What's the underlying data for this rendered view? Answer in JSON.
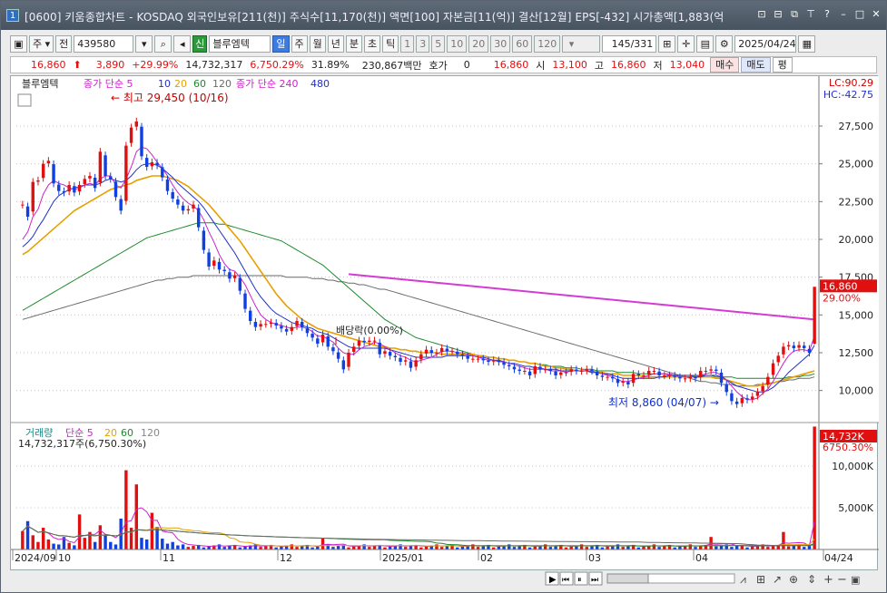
{
  "window": {
    "number": "1",
    "title": "[0600] 키움종합차트 - KOSDAQ 외국인보유[211(천)] 주식수[11,170(천)] 액면[100] 자본금[11(억)] 결산[12월] EPS[-432] 시가총액[1,883(억"
  },
  "toolbar": {
    "market": "주",
    "prev_label": "전",
    "code": "439580",
    "tag": "신",
    "name": "블루엠텍",
    "periods": [
      "일",
      "주",
      "월",
      "년",
      "분",
      "초",
      "틱"
    ],
    "active_period": "일",
    "intervals": [
      "1",
      "3",
      "5",
      "10",
      "20",
      "30",
      "60",
      "120"
    ],
    "count": "145",
    "total": "/331",
    "date": "2025/04/24"
  },
  "quote": {
    "price": "16,860",
    "change": "3,890",
    "change_pct": "+29.99%",
    "volume": "14,732,317",
    "volume_pct": "6,750.29%",
    "turnover": "31.89%",
    "amount": "230,867백만",
    "bid_label": "호가",
    "bid_value": "0",
    "bid_price": "16,860",
    "open_label": "시",
    "open": "13,100",
    "high_label": "고",
    "high": "16,860",
    "low_label": "저",
    "low": "13,040",
    "buy": "매수",
    "sell": "매도",
    "flat": "평"
  },
  "chart_data": [
    {
      "type": "candlestick",
      "legend": [
        "블루엠텍",
        "종가 단순 5",
        "10",
        "20",
        "60",
        "120",
        "종가 단순 240",
        "480"
      ],
      "y_ticks": [
        10000,
        12500,
        15000,
        17500,
        20000,
        22500,
        25000,
        27500
      ],
      "ylim": [
        8000,
        30800
      ],
      "indicators": {
        "lc": "LC:90.29",
        "hc": "HC:-42.75"
      },
      "last_price_label": "16,860",
      "last_pct_label": "29.00%",
      "annotations": {
        "high": "최고 29,450 (10/16)",
        "low": "최저 8,860 (04/07)",
        "dividend": "배당락(0.00%)"
      },
      "x_labels": [
        "2024/09",
        "10",
        "11",
        "12",
        "2025/01",
        "02",
        "03",
        "04",
        "04/24"
      ],
      "closes": [
        22300,
        21500,
        23800,
        23900,
        25000,
        25200,
        23700,
        23200,
        23100,
        23600,
        23100,
        23600,
        24000,
        24200,
        23400,
        25800,
        24200,
        24000,
        22800,
        21900,
        26200,
        27400,
        27800,
        25500,
        24800,
        25100,
        24900,
        24100,
        23200,
        22700,
        22300,
        21900,
        22000,
        22300,
        20800,
        19300,
        18200,
        18600,
        18000,
        17900,
        17400,
        17600,
        16600,
        15400,
        14600,
        14200,
        14400,
        14400,
        14500,
        14300,
        14100,
        13900,
        14200,
        14600,
        14200,
        13800,
        13500,
        13100,
        13700,
        12900,
        12600,
        12100,
        11400,
        12500,
        12900,
        13300,
        13200,
        13300,
        13300,
        12400,
        12600,
        12300,
        12200,
        11900,
        12000,
        11500,
        12000,
        12400,
        12700,
        12500,
        12500,
        12800,
        12600,
        12600,
        12400,
        12300,
        12100,
        12100,
        12100,
        12000,
        11900,
        12000,
        11900,
        11700,
        11600,
        11400,
        11300,
        11300,
        11000,
        11600,
        11400,
        11400,
        11300,
        11000,
        11200,
        11200,
        11400,
        11300,
        11300,
        11400,
        11300,
        11000,
        10900,
        10900,
        10800,
        10500,
        10600,
        10400,
        11100,
        11000,
        11000,
        11300,
        11300,
        11000,
        11000,
        11000,
        10900,
        10800,
        10800,
        10900,
        10800,
        11300,
        11300,
        11400,
        11300,
        10500,
        9900,
        9300,
        9100,
        9500,
        9400,
        9600,
        9900,
        10300,
        10900,
        11800,
        12300,
        12900,
        13000,
        12800,
        13000,
        12800,
        12500,
        16860
      ],
      "ma5": [
        20000,
        20500,
        21500,
        22000,
        23000,
        23600,
        23900,
        23700,
        23600,
        23400,
        23300,
        23400,
        23600,
        23700,
        23600,
        24000,
        24200,
        24200,
        23600,
        23400,
        24000,
        24800,
        25800,
        26100,
        26000,
        25600,
        25100,
        24700,
        24200,
        23600,
        23100,
        22700,
        22400,
        22200,
        21900,
        21300,
        20500,
        19800,
        19000,
        18400,
        18000,
        17900,
        17500,
        17000,
        16300,
        15600,
        15000,
        14700,
        14500,
        14400,
        14300,
        14200,
        14100,
        14200,
        14200,
        14100,
        13900,
        13600,
        13600,
        13400,
        13200,
        12800,
        12500,
        12400,
        12400,
        12700,
        12900,
        13000,
        13200,
        13100,
        12900,
        12700,
        12500,
        12300,
        12200,
        12000,
        11900,
        12000,
        12100,
        12200,
        12400,
        12600,
        12600,
        12600,
        12500,
        12500,
        12400,
        12300,
        12200,
        12100,
        12000,
        12000,
        11900,
        11900,
        11800,
        11700,
        11600,
        11500,
        11400,
        11400,
        11400,
        11400,
        11300,
        11300,
        11300,
        11200,
        11300,
        11300,
        11300,
        11300,
        11300,
        11200,
        11100,
        11000,
        10900,
        10700,
        10600,
        10600,
        10700,
        10800,
        10900,
        11000,
        11100,
        11100,
        11100,
        11100,
        11000,
        10900,
        10900,
        10900,
        10900,
        11000,
        11100,
        11200,
        11200,
        11000,
        10700,
        10300,
        9900,
        9600,
        9400,
        9400,
        9500,
        9800,
        10100,
        10600,
        11200,
        11800,
        12300,
        12600,
        12700,
        12700,
        12600,
        13600
      ],
      "ma10": [
        19500,
        19800,
        20200,
        20800,
        21300,
        21900,
        22500,
        22900,
        23100,
        23300,
        23400,
        23500,
        23600,
        23600,
        23600,
        23700,
        23900,
        24000,
        23900,
        23800,
        23900,
        24200,
        24600,
        24900,
        25000,
        25000,
        24900,
        24700,
        24400,
        24100,
        23700,
        23400,
        23100,
        22800,
        22500,
        22100,
        21600,
        21100,
        20600,
        20100,
        19600,
        19100,
        18500,
        17900,
        17300,
        16700,
        16200,
        15800,
        15400,
        15100,
        14900,
        14700,
        14500,
        14400,
        14300,
        14200,
        14100,
        13900,
        13800,
        13700,
        13500,
        13300,
        13100,
        12900,
        12800,
        12800,
        12800,
        12800,
        12800,
        12800,
        12800,
        12700,
        12600,
        12500,
        12400,
        12300,
        12200,
        12200,
        12200,
        12200,
        12200,
        12200,
        12300,
        12300,
        12300,
        12300,
        12300,
        12300,
        12200,
        12200,
        12100,
        12000,
        12000,
        11900,
        11800,
        11800,
        11700,
        11600,
        11600,
        11500,
        11500,
        11400,
        11400,
        11400,
        11300,
        11300,
        11300,
        11300,
        11300,
        11300,
        11200,
        11200,
        11100,
        11100,
        11000,
        10900,
        10800,
        10800,
        10800,
        10800,
        10800,
        10800,
        10800,
        10900,
        10900,
        11000,
        11000,
        11000,
        11000,
        11000,
        10900,
        10900,
        11000,
        11000,
        11000,
        10900,
        10700,
        10500,
        10300,
        10200,
        10100,
        10000,
        9900,
        9900,
        10000,
        10200,
        10500,
        10800,
        11200,
        11500,
        11800,
        12100,
        12400,
        13000
      ],
      "ma20": [
        19000,
        19200,
        19500,
        19800,
        20100,
        20400,
        20700,
        21000,
        21300,
        21600,
        21900,
        22100,
        22300,
        22500,
        22700,
        22900,
        23100,
        23300,
        23400,
        23500,
        23600,
        23700,
        23900,
        24000,
        24100,
        24200,
        24200,
        24200,
        24100,
        24000,
        23900,
        23700,
        23500,
        23200,
        22900,
        22600,
        22300,
        21900,
        21500,
        21100,
        20700,
        20300,
        19900,
        19400,
        18900,
        18400,
        17900,
        17400,
        16900,
        16400,
        16000,
        15600,
        15300,
        15000,
        14700,
        14500,
        14300,
        14100,
        14000,
        13900,
        13800,
        13700,
        13600,
        13500,
        13400,
        13300,
        13200,
        13100,
        13000,
        12900,
        12900,
        12800,
        12800,
        12700,
        12700,
        12600,
        12600,
        12500,
        12500,
        12500,
        12500,
        12400,
        12400,
        12400,
        12400,
        12400,
        12400,
        12400,
        12300,
        12300,
        12200,
        12200,
        12100,
        12100,
        12000,
        12000,
        11900,
        11900,
        11800,
        11800,
        11700,
        11600,
        11600,
        11500,
        11500,
        11400,
        11400,
        11300,
        11300,
        11300,
        11200,
        11200,
        11200,
        11100,
        11100,
        11100,
        11000,
        11000,
        11000,
        11000,
        10900,
        10900,
        10900,
        10900,
        10900,
        10900,
        10900,
        10900,
        10900,
        10900,
        10900,
        10900,
        10900,
        10900,
        10800,
        10800,
        10700,
        10600,
        10500,
        10400,
        10300,
        10300,
        10300,
        10400,
        10400,
        10500,
        10600,
        10700,
        10800,
        10900,
        11000,
        11100,
        11200,
        11300
      ],
      "ma60": [
        15300,
        15500,
        15700,
        15900,
        16100,
        16300,
        16500,
        16700,
        16900,
        17100,
        17300,
        17500,
        17700,
        17900,
        18100,
        18300,
        18500,
        18700,
        18900,
        19100,
        19300,
        19500,
        19700,
        19900,
        20100,
        20200,
        20300,
        20400,
        20500,
        20600,
        20700,
        20800,
        20900,
        21000,
        21100,
        21100,
        21100,
        21100,
        21000,
        21000,
        20900,
        20800,
        20700,
        20600,
        20500,
        20400,
        20300,
        20200,
        20100,
        20000,
        19900,
        19700,
        19500,
        19300,
        19100,
        18900,
        18700,
        18500,
        18300,
        18000,
        17700,
        17400,
        17100,
        16800,
        16500,
        16200,
        15900,
        15600,
        15300,
        15000,
        14700,
        14500,
        14300,
        14100,
        13900,
        13700,
        13500,
        13400,
        13300,
        13200,
        13100,
        13000,
        12900,
        12800,
        12700,
        12600,
        12500,
        12400,
        12300,
        12300,
        12200,
        12200,
        12100,
        12100,
        12000,
        12000,
        11900,
        11900,
        11800,
        11800,
        11700,
        11700,
        11600,
        11600,
        11600,
        11500,
        11500,
        11500,
        11400,
        11400,
        11400,
        11300,
        11300,
        11300,
        11300,
        11200,
        11200,
        11200,
        11200,
        11100,
        11100,
        11100,
        11100,
        11100,
        11100,
        11000,
        11000,
        11000,
        11000,
        11000,
        11000,
        11000,
        11000,
        11000,
        10900,
        10900,
        10900,
        10900,
        10800,
        10800,
        10800,
        10800,
        10800,
        10800,
        10800,
        10800,
        10800,
        10800,
        10900,
        10900,
        10900,
        11000,
        11000,
        11100
      ],
      "ma120": [
        14700,
        14800,
        14900,
        15000,
        15100,
        15200,
        15300,
        15400,
        15500,
        15600,
        15700,
        15800,
        15900,
        16000,
        16100,
        16200,
        16300,
        16400,
        16500,
        16600,
        16700,
        16800,
        16900,
        17000,
        17100,
        17200,
        17300,
        17300,
        17400,
        17400,
        17500,
        17500,
        17500,
        17600,
        17600,
        17600,
        17600,
        17600,
        17600,
        17600,
        17600,
        17600,
        17600,
        17600,
        17600,
        17600,
        17600,
        17600,
        17600,
        17600,
        17600,
        17500,
        17500,
        17500,
        17500,
        17500,
        17400,
        17400,
        17400,
        17300,
        17300,
        17200,
        17200,
        17100,
        17100,
        17000,
        17000,
        16900,
        16800,
        16700,
        16700,
        16600,
        16500,
        16400,
        16300,
        16200,
        16100,
        16000,
        15900,
        15800,
        15700,
        15600,
        15500,
        15400,
        15300,
        15200,
        15100,
        15000,
        14900,
        14800,
        14700,
        14600,
        14500,
        14400,
        14300,
        14200,
        14100,
        14000,
        13900,
        13800,
        13700,
        13600,
        13500,
        13400,
        13300,
        13200,
        13100,
        13000,
        12900,
        12800,
        12700,
        12600,
        12500,
        12400,
        12300,
        12200,
        12100,
        12000,
        11900,
        11800,
        11700,
        11600,
        11500,
        11400,
        11300,
        11200,
        11100,
        11000,
        10900,
        10800,
        10700,
        10600,
        10600,
        10500,
        10500,
        10400,
        10400,
        10400,
        10300,
        10300,
        10300,
        10300,
        10400,
        10400,
        10500,
        10500,
        10600,
        10600,
        10700,
        10700,
        10800,
        10800,
        10800,
        10900
      ],
      "ma240": [
        null,
        null,
        null,
        null,
        null,
        null,
        null,
        null,
        null,
        null,
        null,
        null,
        null,
        null,
        null,
        null,
        null,
        null,
        null,
        null,
        null,
        null,
        null,
        null,
        null,
        null,
        null,
        null,
        null,
        null,
        null,
        null,
        null,
        null,
        null,
        null,
        null,
        null,
        null,
        null,
        null,
        null,
        null,
        null,
        null,
        null,
        null,
        null,
        null,
        null,
        null,
        null,
        null,
        null,
        null,
        null,
        null,
        null,
        null,
        null,
        null,
        null,
        null,
        null,
        null,
        null,
        null,
        null,
        null,
        null,
        null,
        null,
        null,
        null,
        null,
        null,
        null,
        null,
        null,
        null,
        null,
        null,
        null,
        null,
        null,
        null,
        null,
        null,
        null,
        null,
        null,
        null,
        null,
        null,
        null,
        null,
        null,
        null,
        null,
        null,
        null,
        null,
        null,
        null,
        null,
        null,
        null,
        null,
        null,
        null,
        null,
        null,
        null,
        null,
        null,
        null,
        null,
        null,
        null,
        null,
        null,
        null,
        null,
        null,
        null,
        null,
        null,
        null,
        null,
        null,
        null,
        null,
        null,
        null,
        null,
        null,
        null,
        null,
        null,
        null,
        null,
        null,
        null,
        null,
        null,
        null,
        null,
        null,
        null,
        null,
        null,
        null,
        null,
        null,
        null
      ]
    },
    {
      "type": "bar",
      "legend": [
        "거래량",
        "단순 5",
        "20",
        "60",
        "120"
      ],
      "info": "14,732,317주(6,750.30%)",
      "y_ticks": [
        5000,
        10000
      ],
      "y_tick_labels": [
        "5,000K",
        "10,000K"
      ],
      "ylim": [
        0,
        15000
      ],
      "last_label": "14,732K",
      "last_pct_label": "6750.30%",
      "unit": "K"
    }
  ]
}
